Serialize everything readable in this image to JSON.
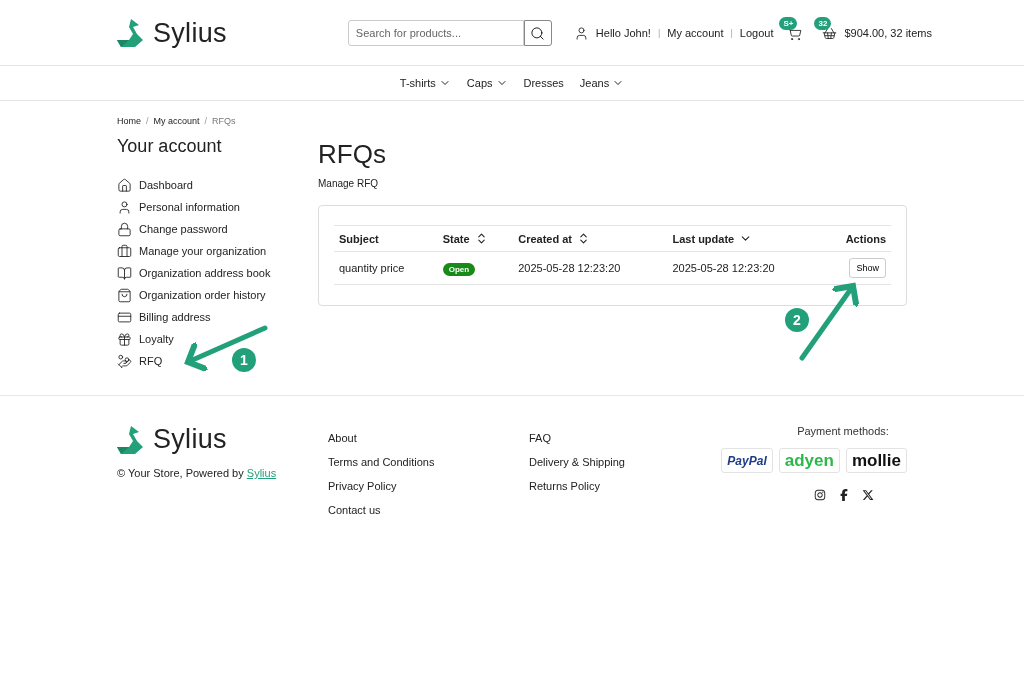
{
  "header": {
    "logo_text": "Sylius",
    "search": {
      "placeholder": "Search for products..."
    },
    "greeting": "Hello John!",
    "separator": "|",
    "links": [
      "My account",
      "Logout"
    ],
    "compare_badge": "S+",
    "cart": {
      "count": "32",
      "total": "$904.00, 32 items"
    }
  },
  "nav": [
    {
      "label": "T-shirts",
      "dropdown": true
    },
    {
      "label": "Caps",
      "dropdown": true
    },
    {
      "label": "Dresses",
      "dropdown": false
    },
    {
      "label": "Jeans",
      "dropdown": true
    }
  ],
  "breadcrumb": [
    "Home",
    "My account",
    "RFQs"
  ],
  "breadcrumb_separator": "/",
  "sidebar": {
    "title": "Your account",
    "items": [
      {
        "kind": "home",
        "label": "Dashboard"
      },
      {
        "kind": "user",
        "label": "Personal information"
      },
      {
        "kind": "lock",
        "label": "Change password"
      },
      {
        "kind": "briefcase",
        "label": "Manage your organization"
      },
      {
        "kind": "book",
        "label": "Organization address book"
      },
      {
        "kind": "bag",
        "label": "Organization order history"
      },
      {
        "kind": "card",
        "label": "Billing address"
      },
      {
        "kind": "gift",
        "label": "Loyalty"
      },
      {
        "kind": "hand",
        "label": "RFQ"
      }
    ]
  },
  "main": {
    "title": "RFQs",
    "subtitle": "Manage RFQ",
    "table": {
      "columns": [
        {
          "label": "Subject",
          "sortable": false,
          "sorted": false
        },
        {
          "label": "State",
          "sortable": true,
          "sorted": false
        },
        {
          "label": "Created at",
          "sortable": true,
          "sorted": false
        },
        {
          "label": "Last update",
          "sortable": true,
          "sorted": true
        },
        {
          "label": "Actions",
          "sortable": false,
          "sorted": false
        }
      ],
      "rows": [
        {
          "subject": "quantity price",
          "state": "Open",
          "created_at": "2025-05-28 12:23:20",
          "last_update": "2025-05-28 12:23:20",
          "action": "Show"
        }
      ]
    }
  },
  "annotations": [
    {
      "number": "1"
    },
    {
      "number": "2"
    }
  ],
  "footer": {
    "logo_text": "Sylius",
    "copyright": "© Your Store, Powered by ",
    "copyright_link": "Sylius",
    "links_1": [
      "About",
      "Terms and Conditions",
      "Privacy Policy",
      "Contact us"
    ],
    "links_2": [
      "FAQ",
      "Delivery & Shipping",
      "Returns Policy"
    ],
    "payment_title": "Payment methods:",
    "payments": [
      {
        "kind": "paypal",
        "label": "PayPal"
      },
      {
        "kind": "adyen",
        "label": "adyen"
      },
      {
        "kind": "mollie",
        "label": "mollie"
      }
    ],
    "social": [
      {
        "kind": "instagram"
      },
      {
        "kind": "facebook"
      },
      {
        "kind": "x"
      }
    ]
  }
}
